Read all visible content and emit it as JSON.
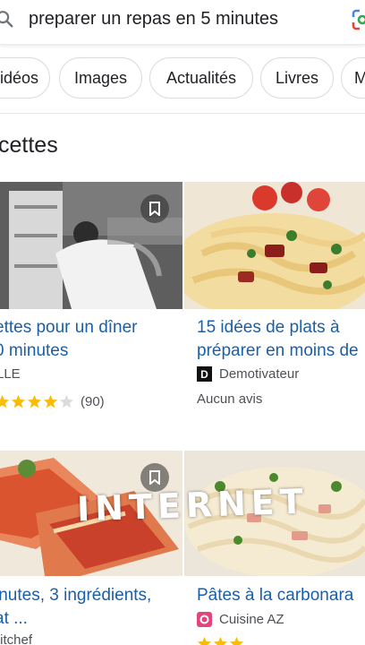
{
  "search": {
    "query": "preparer un repas en 5 minutes"
  },
  "chips": [
    "idéos",
    "Images",
    "Actualités",
    "Livres",
    "M"
  ],
  "section": {
    "title": "cettes"
  },
  "cards": [
    {
      "title_lines": [
        "ettes pour un dîner",
        "0 minutes"
      ],
      "source": "LLE",
      "rating_count": "(90)",
      "stars": 4
    },
    {
      "title_lines": [
        "15 idées de plats à",
        "préparer en moins de"
      ],
      "source": "Demotivateur",
      "source_initial": "D",
      "no_reviews": "Aucun avis"
    },
    {
      "title_lines": [
        "inutes, 3 ingrédients,",
        "at ..."
      ],
      "source": "titchef"
    },
    {
      "title_lines": [
        "Pâtes à la carbonara"
      ],
      "source": "Cuisine AZ"
    }
  ],
  "overlay": {
    "text": "INTERNET"
  },
  "colors": {
    "link": "#1a5fa8",
    "star": "#fbbc04",
    "star_empty": "#dadce0"
  }
}
